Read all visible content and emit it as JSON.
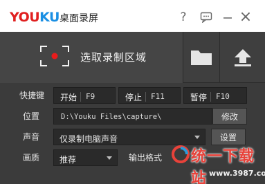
{
  "logo": {
    "you": "YOU",
    "ku": "KU"
  },
  "app_title": "桌面录屏",
  "title_controls": {
    "help": "?",
    "close": "×"
  },
  "main_action": {
    "label": "选取录制区域"
  },
  "hotkeys": {
    "label": "快捷键",
    "items": [
      {
        "name": "开始",
        "key": "F9"
      },
      {
        "name": "停止",
        "key": "F11"
      },
      {
        "name": "暂停",
        "key": "F10"
      }
    ]
  },
  "location": {
    "label": "位置",
    "path": "D:\\Youku Files\\capture\\",
    "modify_label": "修改"
  },
  "audio": {
    "label": "声音",
    "selected": "仅录制电脑声音",
    "settings_label": "设置"
  },
  "quality": {
    "label": "画质",
    "selected": "推荐",
    "output_label": "输出格式"
  },
  "watermark": {
    "text": "统一下载站",
    "url": "www.3987.com"
  },
  "colors": {
    "brand_red": "#e02020",
    "brand_blue": "#1a8fe3",
    "panel_bg": "#3b3b3b",
    "record_dot": "#e81c1c"
  }
}
